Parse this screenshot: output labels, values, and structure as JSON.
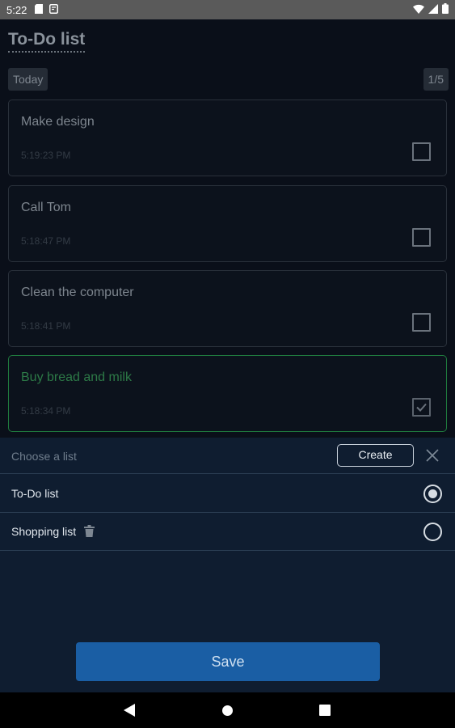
{
  "status_bar": {
    "time": "5:22",
    "icons": [
      "sd-card-icon",
      "app-notification-icon",
      "wifi-icon",
      "signal-icon",
      "battery-icon"
    ]
  },
  "header": {
    "title": "To-Do list",
    "filter_label": "Today",
    "page_counter": "1/5"
  },
  "tasks": [
    {
      "title": "Make design",
      "time": "5:19:23 PM",
      "done": false
    },
    {
      "title": "Call Tom",
      "time": "5:18:47 PM",
      "done": false
    },
    {
      "title": "Clean the computer",
      "time": "5:18:41 PM",
      "done": false
    },
    {
      "title": "Buy bread and milk",
      "time": "5:18:34 PM",
      "done": true
    }
  ],
  "sheet": {
    "title": "Choose a list",
    "create_label": "Create",
    "lists": [
      {
        "name": "To-Do list",
        "selected": true,
        "deletable": false
      },
      {
        "name": "Shopping list",
        "selected": false,
        "deletable": true
      }
    ],
    "save_label": "Save"
  },
  "colors": {
    "accent": "#1a5ea4",
    "done_green": "#1f7a3e",
    "sheet_bg": "#0f1d30"
  }
}
